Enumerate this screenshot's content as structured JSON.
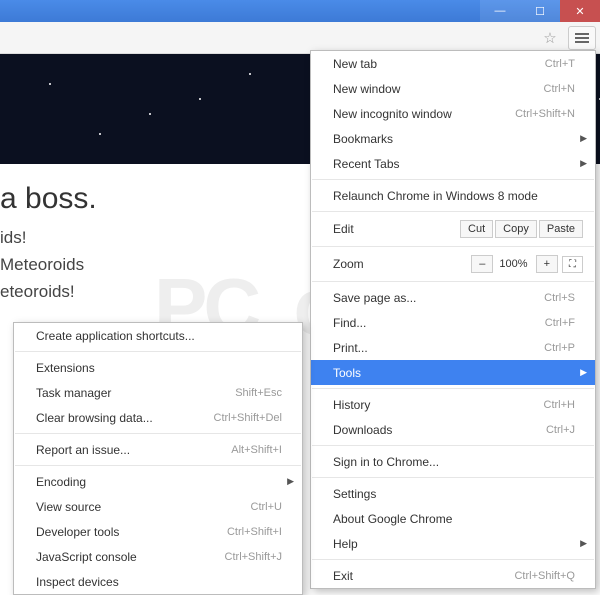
{
  "titlebar": {
    "min": "—",
    "max": "☐",
    "close": "✕"
  },
  "toolbar": {
    "star": "☆"
  },
  "page": {
    "heading": "a boss.",
    "line1": "ids!",
    "line2": "Meteoroids",
    "line3": "eteoroids!"
  },
  "watermark": "PC    .com",
  "mainMenu": {
    "newTab": "New tab",
    "newTabSc": "Ctrl+T",
    "newWin": "New window",
    "newWinSc": "Ctrl+N",
    "incog": "New incognito window",
    "incogSc": "Ctrl+Shift+N",
    "bookmarks": "Bookmarks",
    "recent": "Recent Tabs",
    "relaunch": "Relaunch Chrome in Windows 8 mode",
    "edit": "Edit",
    "cut": "Cut",
    "copy": "Copy",
    "paste": "Paste",
    "zoom": "Zoom",
    "zminus": "–",
    "zpct": "100%",
    "zplus": "+",
    "zfs": "⛶",
    "save": "Save page as...",
    "saveSc": "Ctrl+S",
    "find": "Find...",
    "findSc": "Ctrl+F",
    "print": "Print...",
    "printSc": "Ctrl+P",
    "tools": "Tools",
    "history": "History",
    "historySc": "Ctrl+H",
    "downloads": "Downloads",
    "downloadsSc": "Ctrl+J",
    "signin": "Sign in to Chrome...",
    "settings": "Settings",
    "about": "About Google Chrome",
    "help": "Help",
    "exit": "Exit",
    "exitSc": "Ctrl+Shift+Q"
  },
  "subMenu": {
    "createShort": "Create application shortcuts...",
    "ext": "Extensions",
    "taskmgr": "Task manager",
    "taskmgrSc": "Shift+Esc",
    "clear": "Clear browsing data...",
    "clearSc": "Ctrl+Shift+Del",
    "report": "Report an issue...",
    "reportSc": "Alt+Shift+I",
    "encoding": "Encoding",
    "vsource": "View source",
    "vsourceSc": "Ctrl+U",
    "devtools": "Developer tools",
    "devtoolsSc": "Ctrl+Shift+I",
    "jsconsole": "JavaScript console",
    "jsconsoleSc": "Ctrl+Shift+J",
    "inspect": "Inspect devices"
  }
}
